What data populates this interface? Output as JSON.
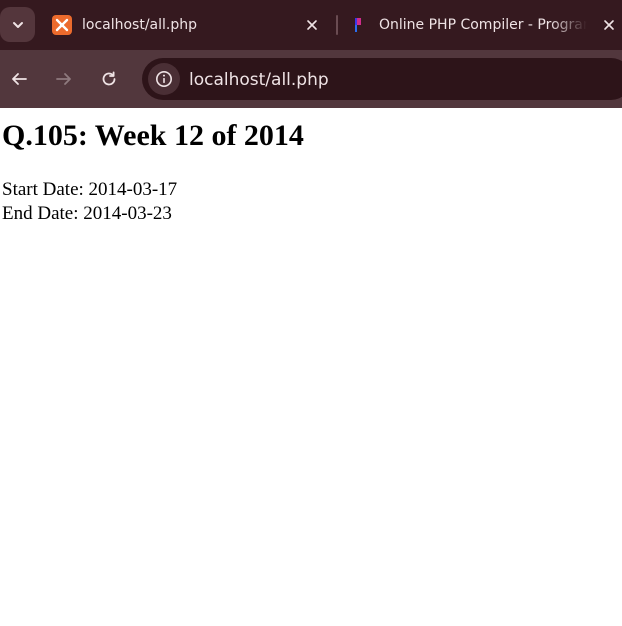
{
  "browser": {
    "tabs": [
      {
        "title": "localhost/all.php",
        "active": true,
        "favicon": "xampp-icon"
      },
      {
        "title": "Online PHP Compiler - Programiz",
        "active": false,
        "favicon": "programiz-icon"
      }
    ],
    "address_bar": {
      "url": "localhost/all.php"
    },
    "colors": {
      "tabstrip": "#35191f",
      "toolbar": "#52373d",
      "omnibox": "#2d1419",
      "text": "#efe3e5",
      "xampp_orange": "#ec6b2d"
    }
  },
  "page": {
    "heading": "Q.105: Week 12 of 2014",
    "start_date": "Start Date: 2014-03-17",
    "end_date": "End Date: 2014-03-23"
  }
}
